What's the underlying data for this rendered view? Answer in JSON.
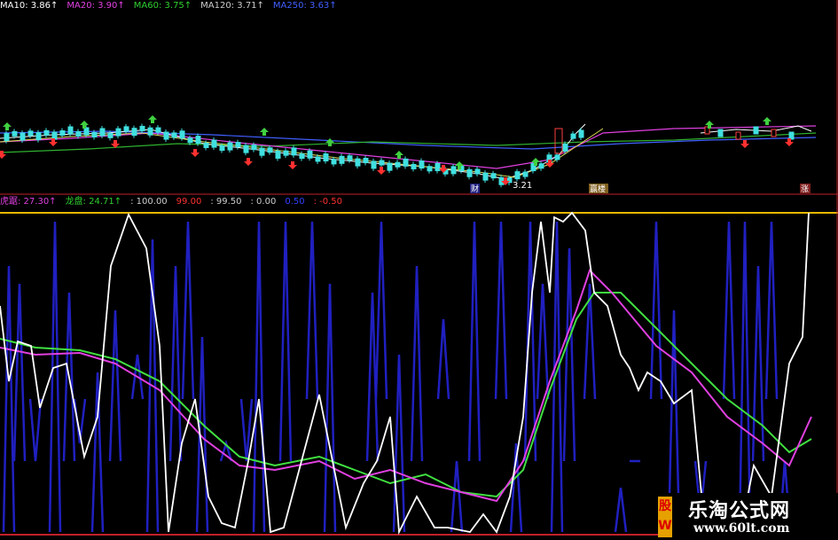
{
  "top_legend": [
    {
      "text": "MA10: 3.86↑",
      "color": "#ffffff"
    },
    {
      "text": "MA20: 3.90↑",
      "color": "#e040e0"
    },
    {
      "text": "MA60: 3.75↑",
      "color": "#30d030"
    },
    {
      "text": "MA120: 3.71↑",
      "color": "#cccccc"
    },
    {
      "text": "MA250: 3.63↑",
      "color": "#4060ff"
    }
  ],
  "mid_legend": [
    {
      "text": "虎踞: 27.30↑",
      "color": "#e040e0"
    },
    {
      "text": "龙盘: 24.71↑",
      "color": "#30d030"
    },
    {
      "text": ": 100.00",
      "color": "#cccccc"
    },
    {
      "text": "99.00",
      "color": "#ff3030"
    },
    {
      "text": ": 99.50",
      "color": "#cccccc"
    },
    {
      "text": ": 0.00",
      "color": "#cccccc"
    },
    {
      "text": "0.50",
      "color": "#3040ff"
    },
    {
      "text": ": -0.50",
      "color": "#ff3030"
    }
  ],
  "price_labels": {
    "low_price": "3.21",
    "marker_cai": "财",
    "marker_ying": "赢楼",
    "marker_zhang": "涨"
  },
  "watermark": {
    "badge": "股W",
    "title": "乐淘公式网",
    "url": "www.60lt.com"
  },
  "colors": {
    "background": "#000000",
    "divider_top": "#e6b800",
    "divider_red": "#c0202a",
    "white_line": "#ffffff",
    "magenta_line": "#e040e0",
    "green_line": "#40e040",
    "blue_bars": "#2020c0"
  }
}
